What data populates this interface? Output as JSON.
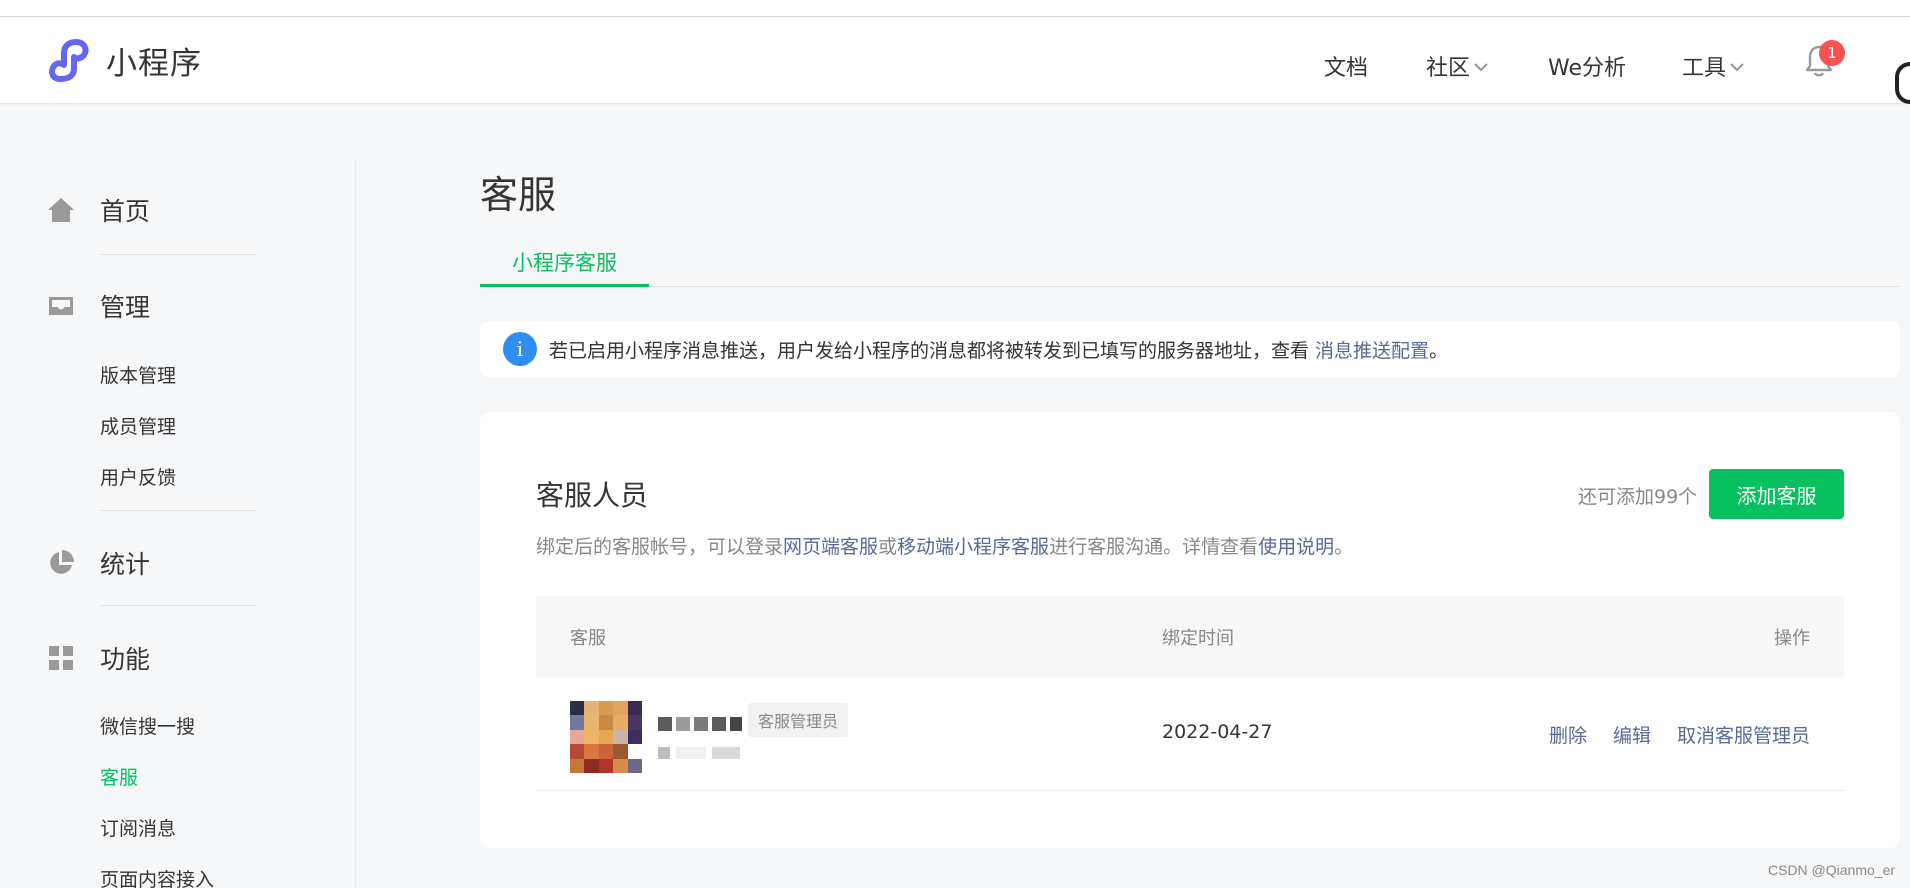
{
  "header": {
    "brand": "小程序",
    "nav": [
      {
        "label": "文档",
        "dropdown": false
      },
      {
        "label": "社区",
        "dropdown": true
      },
      {
        "label": "We分析",
        "dropdown": false
      },
      {
        "label": "工具",
        "dropdown": true
      }
    ],
    "notification_count": "1"
  },
  "sidebar": {
    "sections": [
      {
        "label": "首页",
        "icon": "home-icon"
      },
      {
        "label": "管理",
        "icon": "inbox-icon",
        "items": [
          "版本管理",
          "成员管理",
          "用户反馈"
        ]
      },
      {
        "label": "统计",
        "icon": "pie-chart-icon"
      },
      {
        "label": "功能",
        "icon": "grid-icon",
        "items": [
          "微信搜一搜",
          "客服",
          "订阅消息",
          "页面内容接入"
        ]
      }
    ],
    "active_item": "客服"
  },
  "main": {
    "title": "客服",
    "tab": "小程序客服",
    "notice": {
      "text": "若已启用小程序消息推送，用户发给小程序的消息都将被转发到已填写的服务器地址，查看 ",
      "link": "消息推送配置",
      "suffix": "。"
    },
    "card": {
      "title": "客服人员",
      "remain": "还可添加99个",
      "add_button": "添加客服",
      "desc_prefix": "绑定后的客服帐号，可以登录",
      "desc_link1": "网页端客服",
      "desc_or": "或",
      "desc_link2": "移动端小程序客服",
      "desc_mid": "进行客服沟通。详情查看",
      "desc_link3": "使用说明",
      "desc_suffix": "。",
      "table": {
        "headers": [
          "客服",
          "绑定时间",
          "操作"
        ],
        "rows": [
          {
            "role": "客服管理员",
            "bind_time": "2022-04-27",
            "actions": [
              "删除",
              "编辑",
              "取消客服管理员"
            ]
          }
        ]
      }
    }
  },
  "watermark": "CSDN @Qianmo_er",
  "colors": {
    "accent": "#07c160",
    "link": "#576b95",
    "badge": "#fa5151",
    "info": "#2f8ef0"
  }
}
